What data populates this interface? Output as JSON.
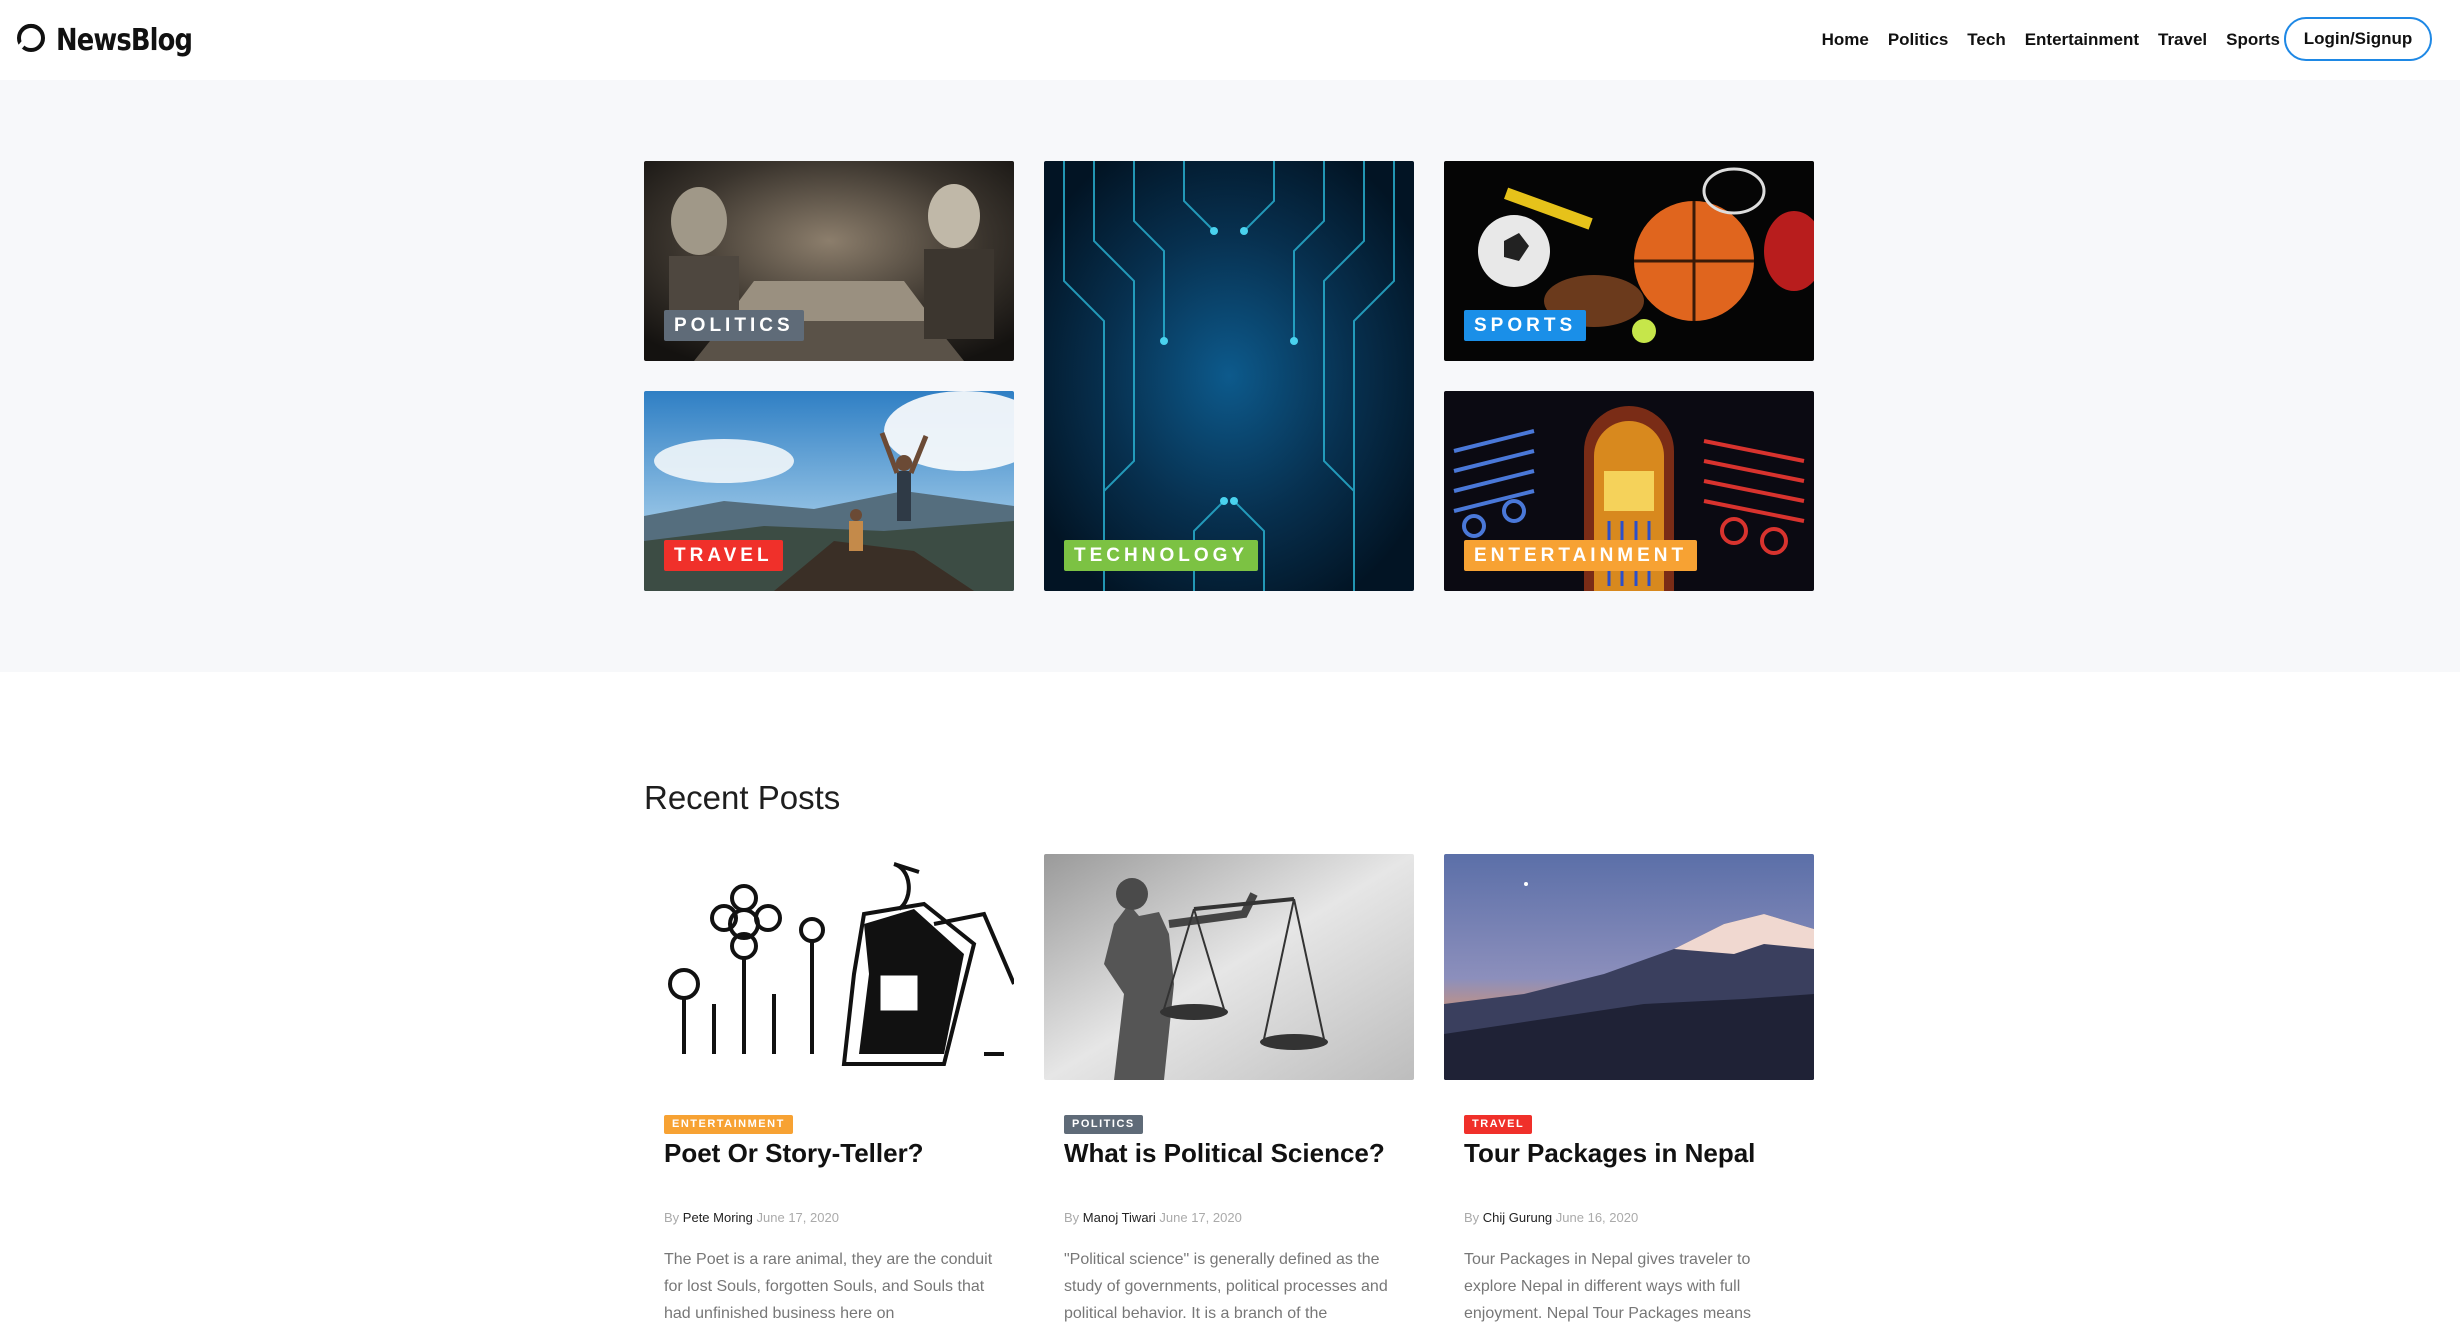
{
  "brand": {
    "name": "NewsBlog"
  },
  "nav": {
    "items": [
      "Home",
      "Politics",
      "Tech",
      "Entertainment",
      "Travel",
      "Sports"
    ],
    "login_label": "Login/Signup"
  },
  "hero": {
    "tiles": [
      {
        "label": "POLITICS",
        "color": "#5f6b78"
      },
      {
        "label": "TECHNOLOGY",
        "color": "#7cc243"
      },
      {
        "label": "SPORTS",
        "color": "#1a8fe8"
      },
      {
        "label": "TRAVEL",
        "color": "#f0302a"
      },
      {
        "label": "ENTERTAINMENT",
        "color": "#f7a233"
      }
    ]
  },
  "recent": {
    "title": "Recent Posts",
    "posts": [
      {
        "category": "ENTERTAINMENT",
        "category_color": "#f7a233",
        "title": "Poet Or Story-Teller?",
        "by": "By",
        "author": "Pete Moring",
        "date": "June 17, 2020",
        "excerpt": "The Poet is a rare animal, they are the conduit for lost Souls, forgotten Souls, and Souls that had unfinished business here on"
      },
      {
        "category": "POLITICS",
        "category_color": "#5f6b78",
        "title": "What is Political Science?",
        "by": "By",
        "author": "Manoj Tiwari",
        "date": "June 17, 2020",
        "excerpt": "\"Political science\" is generally defined as the study of governments, political processes and political behavior. It is a branch of the"
      },
      {
        "category": "TRAVEL",
        "category_color": "#f0302a",
        "title": "Tour Packages in Nepal",
        "by": "By",
        "author": "Chij Gurung",
        "date": "June 16, 2020",
        "excerpt": "Tour Packages in Nepal gives traveler to explore Nepal in different ways with full enjoyment. Nepal Tour Packages means"
      }
    ]
  }
}
